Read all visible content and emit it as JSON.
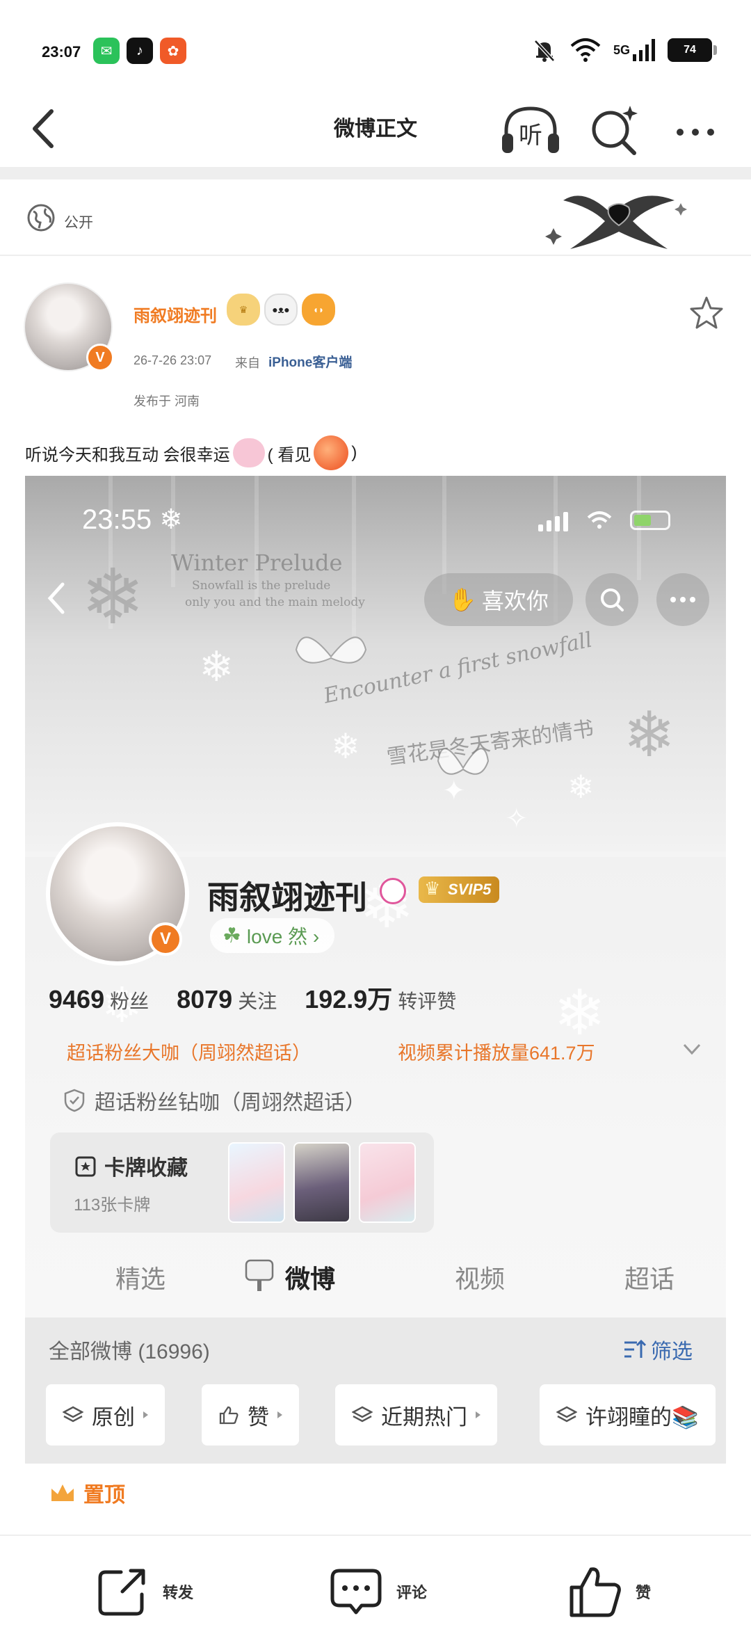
{
  "status_bar": {
    "time": "23:07",
    "network": "5G",
    "battery": "74",
    "apps": [
      {
        "name": "wechat",
        "glyph": "✉",
        "color": "#2bc25a"
      },
      {
        "name": "douyin",
        "glyph": "♪",
        "color": "#111111"
      },
      {
        "name": "kuaikan",
        "glyph": "✿",
        "color": "#f05a28"
      }
    ]
  },
  "nav": {
    "title": "微博正文",
    "listen_label": "听"
  },
  "post": {
    "visibility": "公开",
    "author": {
      "name": "雨叙翊迹刊",
      "verified_mark": "V"
    },
    "time": "26-7-26 23:07",
    "from_label": "来自",
    "client": "iPhone客户端",
    "location": "发布于 河南",
    "text_part1": "听说今天和我互动 会很幸运",
    "text_part2": "( 看见",
    "text_part3": ")"
  },
  "screenshot": {
    "status_time": "23:55 ❄",
    "like_label": "喜欢你",
    "banner_title": "Winter Prelude",
    "banner_sub1": "Snowfall is the prelude",
    "banner_sub2": "only you and the main melody",
    "banner_cursive": "Encounter a first snowfall",
    "banner_cn": "雪花是冬天寄来的情书",
    "profile_name": "雨叙翊迹刊",
    "svip": "SVIP5",
    "tag": "love 然 ›",
    "stats": {
      "fans_num": "9469",
      "fans_label": "粉丝",
      "follow_num": "8079",
      "follow_label": "关注",
      "interact_num": "192.9万",
      "interact_label": "转评赞"
    },
    "badge1": "超话粉丝大咖（周翊然超话）",
    "badge2": "视频累计播放量641.7万",
    "badge3": "超话粉丝钻咖（周翊然超话）",
    "cards_title": "卡牌收藏",
    "cards_count": "113张卡牌",
    "tabs": [
      "精选",
      "微博",
      "视频",
      "超话"
    ],
    "all_weibo": "全部微博 (16996)",
    "filter_label": "筛选",
    "chips": [
      "原创",
      "赞",
      "近期热门",
      "许翊瞳的📚"
    ]
  },
  "pinned_label": "置顶",
  "bottom_bar": {
    "repost": "转发",
    "comment": "评论",
    "like": "赞"
  },
  "colors": {
    "accent_orange": "#f07b22",
    "link_blue": "#3a5f94"
  }
}
